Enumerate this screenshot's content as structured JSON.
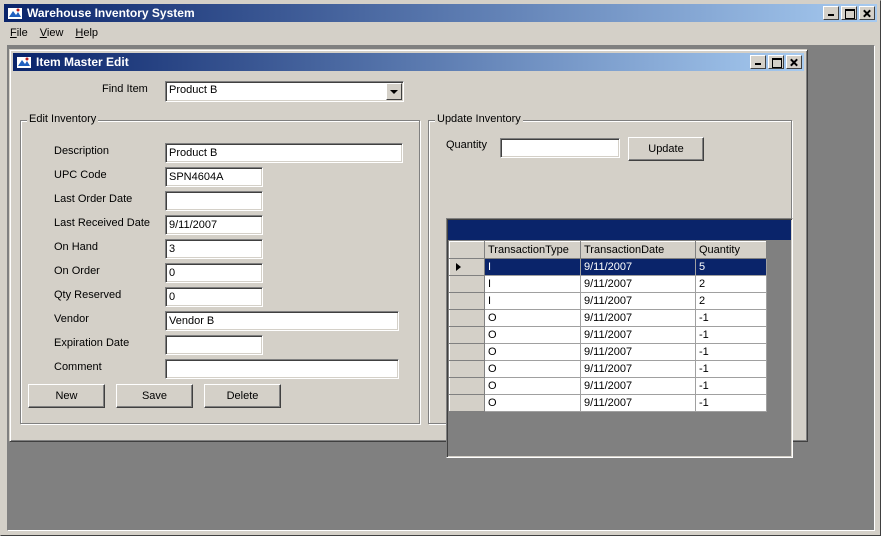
{
  "app": {
    "title": "Warehouse Inventory System"
  },
  "menu": {
    "items": [
      {
        "label": "File",
        "u": "F"
      },
      {
        "label": "View",
        "u": "V"
      },
      {
        "label": "Help",
        "u": "H"
      }
    ]
  },
  "child": {
    "title": "Item Master Edit"
  },
  "find": {
    "label": "Find Item",
    "value": "Product B"
  },
  "edit": {
    "group_title": "Edit Inventory",
    "fields": [
      {
        "label": "Description",
        "value": "Product B"
      },
      {
        "label": "UPC Code",
        "value": "SPN4604A"
      },
      {
        "label": "Last Order Date",
        "value": ""
      },
      {
        "label": "Last Received Date",
        "value": "9/11/2007"
      },
      {
        "label": "On Hand",
        "value": "3"
      },
      {
        "label": "On Order",
        "value": "0"
      },
      {
        "label": "Qty Reserved",
        "value": "0"
      },
      {
        "label": "Vendor",
        "value": "Vendor B"
      },
      {
        "label": "Expiration Date",
        "value": ""
      },
      {
        "label": "Comment",
        "value": ""
      }
    ],
    "buttons": {
      "new": "New",
      "save": "Save",
      "delete": "Delete"
    }
  },
  "update": {
    "group_title": "Update Inventory",
    "quantity_label": "Quantity",
    "quantity_value": "",
    "update_button": "Update",
    "grid": {
      "columns": [
        "TransactionType",
        "TransactionDate",
        "Quantity"
      ],
      "rows": [
        [
          "I",
          "9/11/2007",
          "5"
        ],
        [
          "I",
          "9/11/2007",
          "2"
        ],
        [
          "I",
          "9/11/2007",
          "2"
        ],
        [
          "O",
          "9/11/2007",
          "-1"
        ],
        [
          "O",
          "9/11/2007",
          "-1"
        ],
        [
          "O",
          "9/11/2007",
          "-1"
        ],
        [
          "O",
          "9/11/2007",
          "-1"
        ],
        [
          "O",
          "9/11/2007",
          "-1"
        ],
        [
          "O",
          "9/11/2007",
          "-1"
        ]
      ],
      "selected_row": 0
    }
  },
  "colors": {
    "title_start": "#0a246a",
    "title_end": "#a6caf0",
    "face": "#d4d0c8",
    "selection": "#0a246a"
  }
}
